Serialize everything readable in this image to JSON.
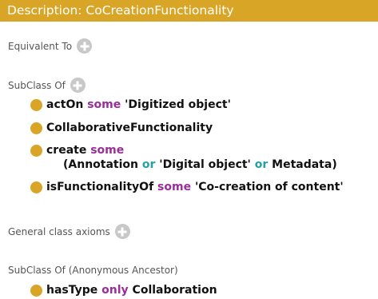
{
  "title": "Description: CoCreationFunctionality",
  "sections": {
    "equivalent_to": "Equivalent To",
    "subclass_of": "SubClass Of",
    "general_axioms": "General class axioms",
    "anon_ancestor": "SubClass Of (Anonymous Ancestor)"
  },
  "axioms": {
    "a1": {
      "prop": "actOn",
      "q": "some",
      "filler": "'Digitized object'"
    },
    "a2": {
      "filler": "CollaborativeFunctionality"
    },
    "a3": {
      "prop": "create",
      "q": "some",
      "open": "(",
      "c1": "Annotation",
      "or1": "or",
      "c2": "'Digital object'",
      "or2": "or",
      "c3": "Metadata",
      "close": ")"
    },
    "a4": {
      "prop": "isFunctionalityOf",
      "q": "some",
      "filler": "'Co-creation of content'"
    },
    "a5": {
      "prop": "hasType",
      "q": "only",
      "filler": "Collaboration"
    }
  },
  "colors": {
    "title_bg": "#d8a526",
    "bullet": "#d8a526",
    "quantifier": "#9b2d9b",
    "or_keyword": "#22a1a7",
    "add_button": "#c8c8c8"
  },
  "icons": {
    "add": "add-circle-icon",
    "bullet": "axiom-bullet-icon"
  }
}
